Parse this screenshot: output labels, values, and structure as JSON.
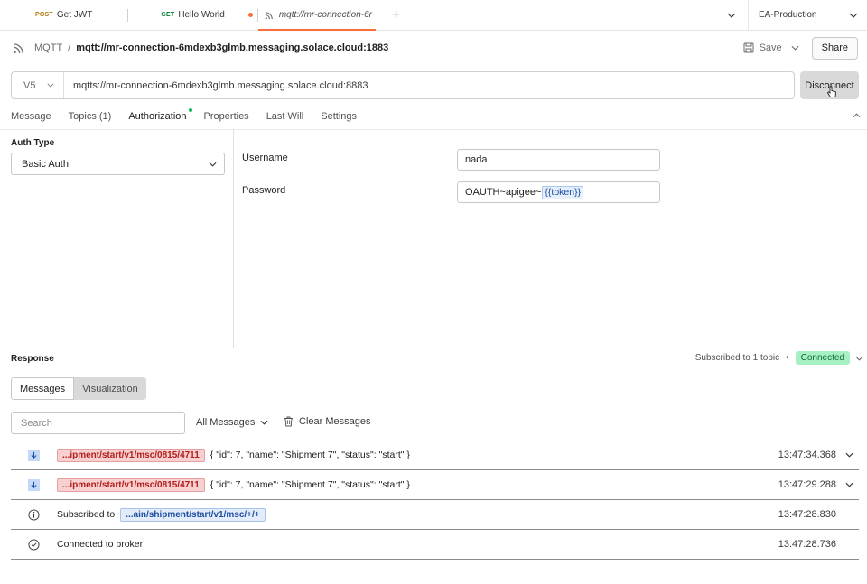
{
  "tabs": [
    {
      "method": "POST",
      "label": "Get JWT"
    },
    {
      "method": "GET",
      "label": "Hello World"
    },
    {
      "method": "",
      "label": "mqtt://mr-connection-6r"
    }
  ],
  "environment": "EA-Production",
  "header": {
    "protocol": "MQTT",
    "name": "mqtt://mr-connection-6mdexb3glmb.messaging.solace.cloud:1883",
    "save_label": "Save",
    "share_label": "Share"
  },
  "urlbar": {
    "version": "V5",
    "url": "mqtts://mr-connection-6mdexb3glmb.messaging.solace.cloud:8883",
    "disconnect_label": "Disconnect"
  },
  "request_tabs": [
    "Message",
    "Topics (1)",
    "Authorization",
    "Properties",
    "Last Will",
    "Settings"
  ],
  "auth": {
    "type_label": "Auth Type",
    "type_value": "Basic Auth",
    "username_label": "Username",
    "username_value": "nada",
    "password_label": "Password",
    "password_prefix": "OAUTH~apigee~",
    "password_variable": "{{token}}"
  },
  "response": {
    "title": "Response",
    "subscribed_text": "Subscribed to 1 topic",
    "status": "Connected",
    "view_tabs": [
      "Messages",
      "Visualization"
    ],
    "search_placeholder": "Search",
    "filter_label": "All Messages",
    "clear_label": "Clear Messages",
    "messages": [
      {
        "topic": "...ipment/start/v1/msc/0815/4711",
        "text": "{ \"id\": 7, \"name\": \"Shipment 7\", \"status\": \"start\" }",
        "time": "13:47:34.368"
      },
      {
        "topic": "...ipment/start/v1/msc/0815/4711",
        "text": "{ \"id\": 7, \"name\": \"Shipment 7\", \"status\": \"start\" }",
        "time": "13:47:29.288"
      },
      {
        "prefix": "Subscribed to",
        "topic": "...ain/shipment/start/v1/msc/+/+",
        "time": "13:47:28.830"
      },
      {
        "text": "Connected to broker",
        "time": "13:47:28.736"
      }
    ]
  }
}
